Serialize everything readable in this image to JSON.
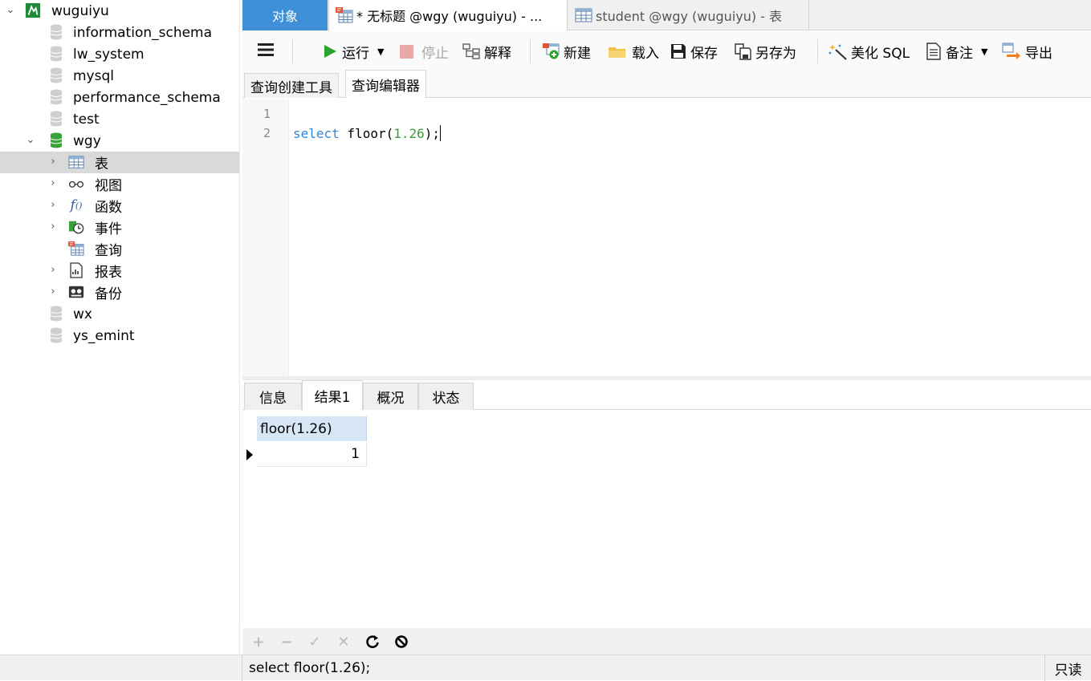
{
  "tree": {
    "connection": "wuguiyu",
    "databases": [
      "information_schema",
      "lw_system",
      "mysql",
      "performance_schema",
      "test"
    ],
    "open_db": "wgy",
    "open_db_children": [
      "表",
      "视图",
      "函数",
      "事件",
      "查询",
      "报表",
      "备份"
    ],
    "more_dbs": [
      "wx",
      "ys_emint"
    ]
  },
  "tabs": {
    "objects": "对象",
    "untitled": "* 无标题 @wgy (wuguiyu) - ...",
    "student": "student @wgy (wuguiyu) - 表"
  },
  "toolbar": {
    "run": "运行",
    "stop": "停止",
    "explain": "解释",
    "new": "新建",
    "load": "载入",
    "save": "保存",
    "save_as": "另存为",
    "beautify": "美化 SQL",
    "note": "备注",
    "export": "导出"
  },
  "subtabs": {
    "builder": "查询创建工具",
    "editor": "查询编辑器"
  },
  "editor": {
    "line_numbers": [
      "1",
      "2"
    ],
    "kw": "select",
    "fn_open": " floor(",
    "arg": "1.26",
    "fn_close": ");"
  },
  "result_tabs": [
    "信息",
    "结果1",
    "概况",
    "状态"
  ],
  "grid": {
    "column": "floor(1.26)",
    "value": "1"
  },
  "status": {
    "sql": "select floor(1.26);",
    "mode": "只读"
  },
  "colors": {
    "accent": "#3d8fd8",
    "keyword": "#2f86d6",
    "number": "#3e9a3e",
    "run_green": "#2aa52a",
    "db_green": "#3aa23a"
  }
}
